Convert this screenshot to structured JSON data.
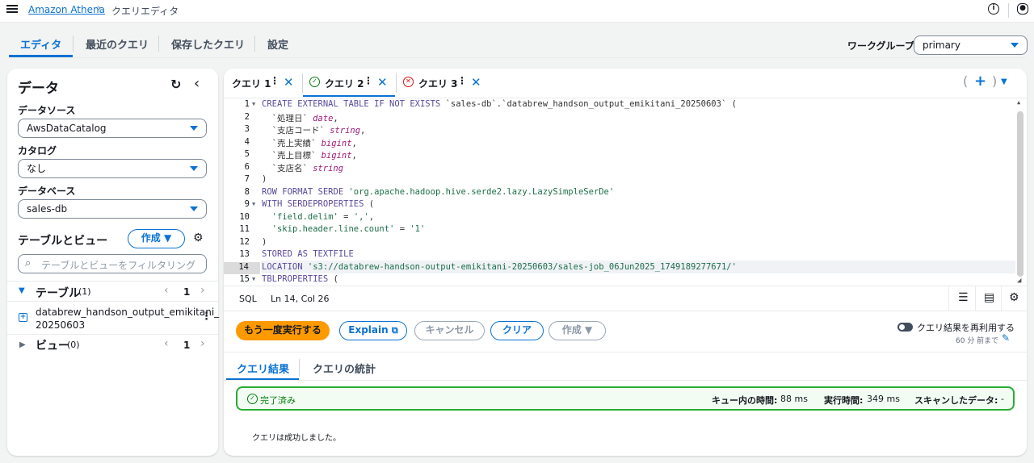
{
  "breadcrumb": {
    "service": "Amazon Athena",
    "current": "クエリエディタ"
  },
  "main_tabs": [
    {
      "label": "エディタ"
    },
    {
      "label": "最近のクエリ"
    },
    {
      "label": "保存したクエリ"
    },
    {
      "label": "設定"
    }
  ],
  "workgroup": {
    "label": "ワークグループ",
    "value": "primary"
  },
  "data_panel": {
    "title": "データ",
    "datasource_label": "データソース",
    "datasource_value": "AwsDataCatalog",
    "catalog_label": "カタログ",
    "catalog_value": "なし",
    "database_label": "データベース",
    "database_value": "sales-db",
    "tables_views_title": "テーブルとビュー",
    "create_label": "作成",
    "filter_placeholder": "テーブルとビューをフィルタリング",
    "tables_label": "テーブル",
    "tables_count": "(1)",
    "tables_page": "1",
    "table_name_line1": "databrew_handson_output_emikitani_",
    "table_name_line2": "20250603",
    "views_label": "ビュー",
    "views_count": "(0)",
    "views_page": "1"
  },
  "query_tabs": [
    {
      "label": "クエリ 1"
    },
    {
      "label": "クエリ 2"
    },
    {
      "label": "クエリ 3"
    }
  ],
  "editor": {
    "line_numbers": [
      "1",
      "2",
      "3",
      "4",
      "5",
      "6",
      "7",
      "8",
      "9",
      "10",
      "11",
      "12",
      "13",
      "14",
      "15"
    ],
    "current_line": "14"
  },
  "status": {
    "language": "SQL",
    "cursor": "Ln 14, Col 26"
  },
  "actions": {
    "rerun": "もう一度実行する",
    "explain": "Explain",
    "cancel": "キャンセル",
    "clear": "クリア",
    "create": "作成",
    "reuse_label": "クエリ結果を再利用する",
    "reuse_age": "60 分 前まで"
  },
  "result_tabs": [
    {
      "label": "クエリ結果"
    },
    {
      "label": "クエリの統計"
    }
  ],
  "result": {
    "status": "完了済み",
    "queue_label": "キュー内の時間:",
    "queue_value": "88 ms",
    "exec_label": "実行時間:",
    "exec_value": "349 ms",
    "scan_label": "スキャンしたデータ:",
    "scan_value": "-",
    "message": "クエリは成功しました。"
  },
  "colors": {
    "accent": "#0972d3",
    "primary_button": "#ff9900",
    "success": "#037f0c"
  }
}
